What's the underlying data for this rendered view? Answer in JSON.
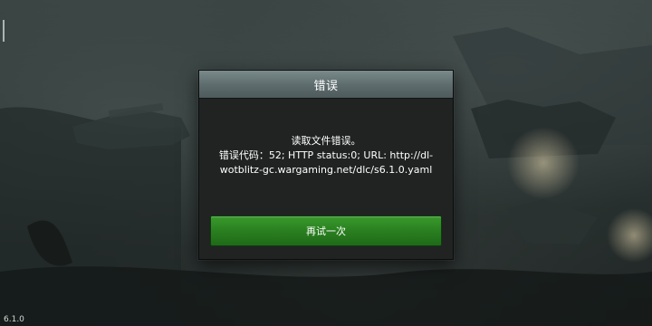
{
  "app": {
    "version": "6.1.0"
  },
  "dialog": {
    "title": "错误",
    "message": {
      "line1": "读取文件错误。",
      "line2": "错误代码：52; HTTP status:0; URL: http://dl-",
      "line3": "wotblitz-gc.wargaming.net/dlc/s6.1.0.yaml"
    },
    "retry_label": "再试一次"
  },
  "colors": {
    "header_gradient_top": "#7a8a8b",
    "header_gradient_bottom": "#4e5a5b",
    "dialog_background": "#202322",
    "retry_button_green": "#2a7f20"
  }
}
